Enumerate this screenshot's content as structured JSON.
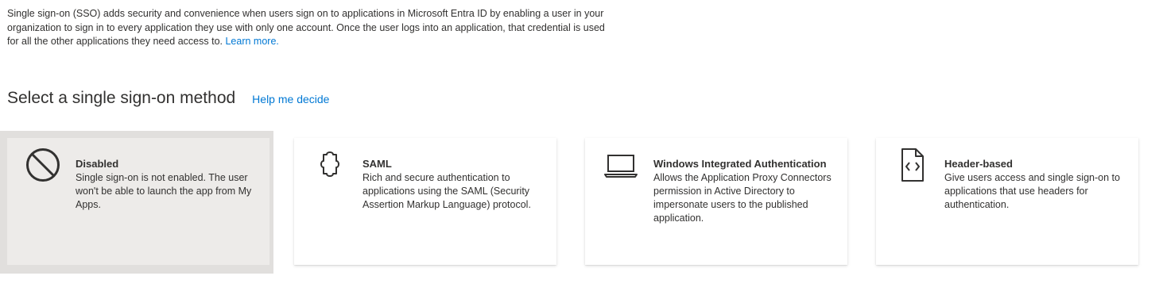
{
  "intro": {
    "text": "Single sign-on (SSO) adds security and convenience when users sign on to applications in Microsoft Entra ID by enabling a user in your organization to sign in to every application they use with only one account. Once the user logs into an application, that credential is used for all the other applications they need access to.",
    "learn_more": "Learn more."
  },
  "section": {
    "title": "Select a single sign-on method",
    "help_link": "Help me decide"
  },
  "methods": [
    {
      "title": "Disabled",
      "description": "Single sign-on is not enabled. The user won't be able to launch the app from My Apps.",
      "icon": "disabled-icon",
      "selected": true
    },
    {
      "title": "SAML",
      "description": "Rich and secure authentication to applications using the SAML (Security Assertion Markup Language) protocol.",
      "icon": "puzzle-piece-icon",
      "selected": false
    },
    {
      "title": "Windows Integrated Authentication",
      "description": "Allows the Application Proxy Connectors permission in Active Directory to impersonate users to the published application.",
      "icon": "laptop-icon",
      "selected": false
    },
    {
      "title": "Header-based",
      "description": "Give users access and single sign-on to applications that use headers for authentication.",
      "icon": "code-document-icon",
      "selected": false
    }
  ],
  "colors": {
    "link": "#0078d4",
    "text": "#323130",
    "selected_card": "#edebe9"
  }
}
